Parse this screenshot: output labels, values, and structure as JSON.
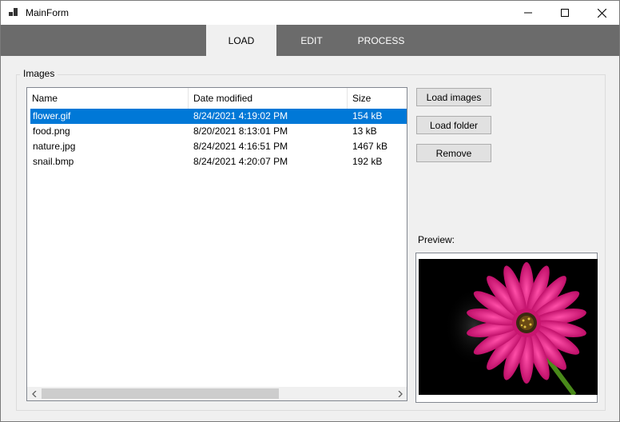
{
  "window": {
    "title": "MainForm",
    "controls": [
      "minimize-icon",
      "maximize-icon",
      "close-icon"
    ]
  },
  "tabs": [
    {
      "label": "LOAD",
      "active": true
    },
    {
      "label": "EDIT",
      "active": false
    },
    {
      "label": "PROCESS",
      "active": false
    }
  ],
  "images_group": {
    "title": "Images",
    "columns": [
      "Name",
      "Date modified",
      "Size"
    ],
    "rows": [
      {
        "name": "flower.gif",
        "date": "8/24/2021 4:19:02 PM",
        "size": "154 kB",
        "selected": true
      },
      {
        "name": "food.png",
        "date": "8/20/2021 8:13:01 PM",
        "size": "13 kB",
        "selected": false
      },
      {
        "name": "nature.jpg",
        "date": "8/24/2021 4:16:51 PM",
        "size": "1467 kB",
        "selected": false
      },
      {
        "name": "snail.bmp",
        "date": "8/24/2021 4:20:07 PM",
        "size": "192 kB",
        "selected": false
      }
    ]
  },
  "buttons": {
    "load_images": "Load images",
    "load_folder": "Load folder",
    "remove": "Remove"
  },
  "preview": {
    "label": "Preview:",
    "image_subject": "pink gerbera flower on black background"
  },
  "colors": {
    "tab_bar": "#6b6b6b",
    "selection": "#0078d7",
    "flower_petal": "#e0187a"
  }
}
